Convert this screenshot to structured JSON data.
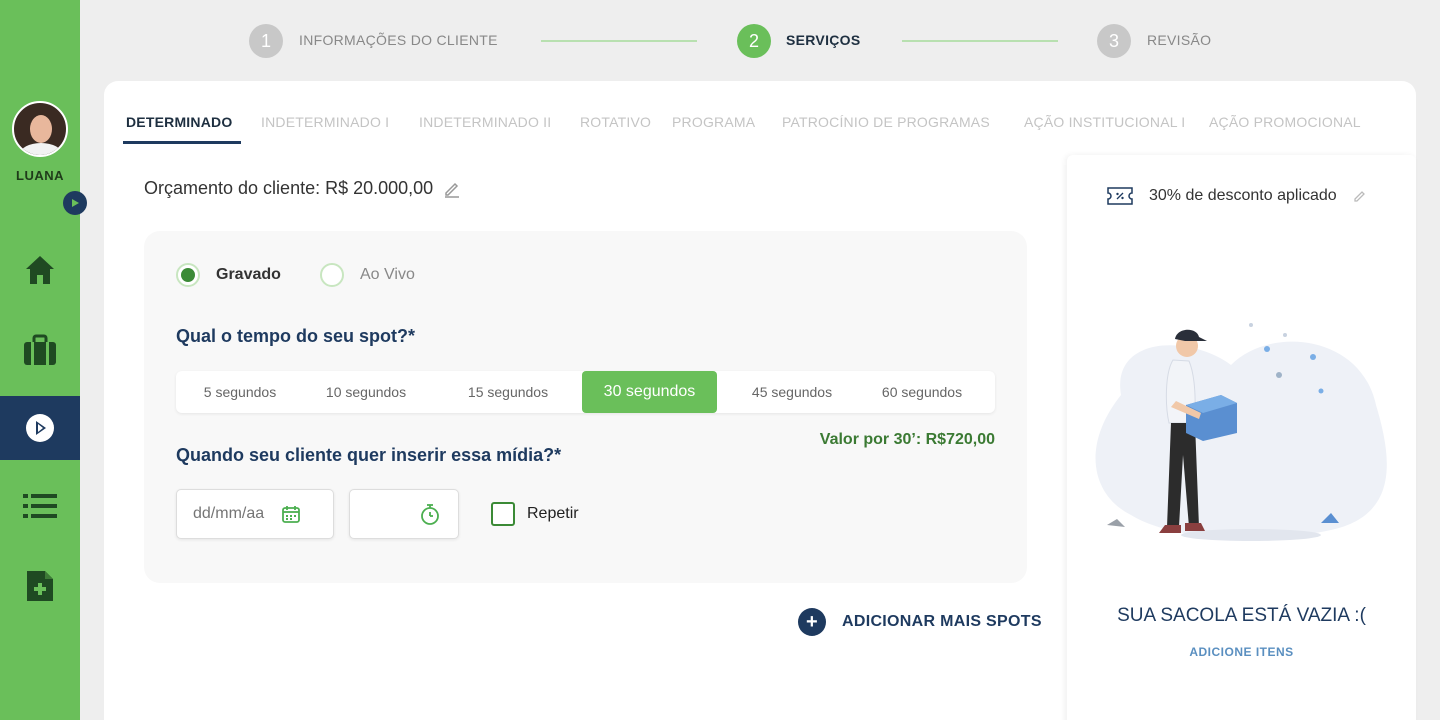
{
  "user": {
    "name": "LUANA"
  },
  "stepper": {
    "steps": [
      {
        "number": "1",
        "label": "INFORMAÇÕES DO CLIENTE",
        "state": "done"
      },
      {
        "number": "2",
        "label": "SERVIÇOS",
        "state": "active"
      },
      {
        "number": "3",
        "label": "REVISÃO",
        "state": "pending"
      }
    ]
  },
  "tabs": [
    "DETERMINADO",
    "INDETERMINADO I",
    "INDETERMINADO II",
    "ROTATIVO",
    "PROGRAMA",
    "PATROCÍNIO DE PROGRAMAS",
    "AÇÃO INSTITUCIONAL I",
    "AÇÃO PROMOCIONAL"
  ],
  "budget": {
    "label": "Orçamento do cliente: R$ 20.000,00"
  },
  "form": {
    "radio_recorded": "Gravado",
    "radio_live": "Ao Vivo",
    "duration_question": "Qual o tempo do seu spot?*",
    "durations": [
      "5 segundos",
      "10 segundos",
      "15 segundos",
      "30 segundos",
      "45 segundos",
      "60 segundos"
    ],
    "selected_duration": "30 segundos",
    "price": "Valor por 30’: R$720,00",
    "date_question": "Quando seu cliente quer inserir essa mídia?*",
    "date_placeholder": "dd/mm/aa",
    "repeat_label": "Repetir"
  },
  "add_more": {
    "label": "ADICIONAR MAIS SPOTS"
  },
  "bag": {
    "discount": "30% de desconto aplicado",
    "empty_title": "SUA SACOLA ESTÁ VAZIA :(",
    "empty_action": "ADICIONE ITENS"
  },
  "colors": {
    "sidebar": "#6abf5a",
    "navy": "#1e3a5f",
    "accent_green": "#6abf5a",
    "price_green": "#3b7a33"
  }
}
